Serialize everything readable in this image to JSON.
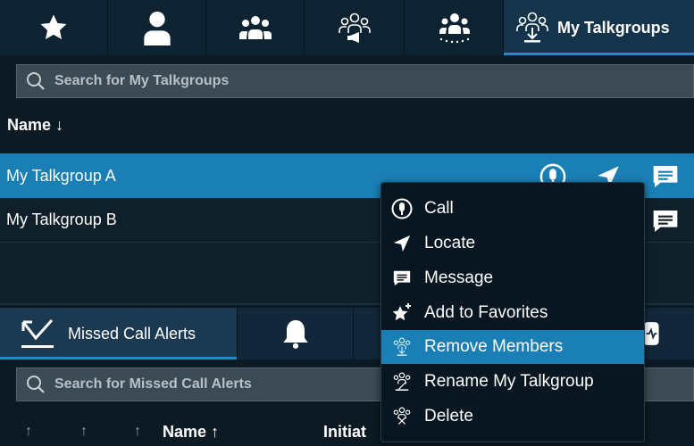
{
  "top_tabs": {
    "active_label": "My Talkgroups",
    "icons": [
      "star-icon",
      "person-icon",
      "group-icon",
      "talkgroup-broadcast-icon",
      "talkgroup-dispatch-icon",
      "my-talkgroups-icon"
    ]
  },
  "search": {
    "placeholder": "Search for My Talkgroups"
  },
  "list": {
    "header": "Name",
    "sort_arrow": "↓",
    "rows": [
      {
        "label": "My Talkgroup A",
        "selected": true
      },
      {
        "label": "My Talkgroup B",
        "selected": false
      }
    ]
  },
  "bottom": {
    "active_tab_label": "Missed Call Alerts",
    "search_placeholder": "Search for Missed Call Alerts",
    "columns": {
      "arrow1": "↑",
      "arrow2": "↑",
      "arrow3": "↑",
      "name": "Name ↑",
      "initiator": "Initiat"
    }
  },
  "context_menu": {
    "items": [
      {
        "label": "Call",
        "icon": "call-icon"
      },
      {
        "label": "Locate",
        "icon": "locate-icon"
      },
      {
        "label": "Message",
        "icon": "message-icon"
      },
      {
        "label": "Add to Favorites",
        "icon": "add-favorite-icon"
      },
      {
        "label": "Remove Members",
        "icon": "remove-members-icon",
        "highlighted": true
      },
      {
        "label": "Rename My Talkgroup",
        "icon": "rename-icon"
      },
      {
        "label": "Delete",
        "icon": "delete-icon"
      }
    ]
  },
  "colors": {
    "accent": "#1a7fb4",
    "background": "#0c1a24"
  }
}
